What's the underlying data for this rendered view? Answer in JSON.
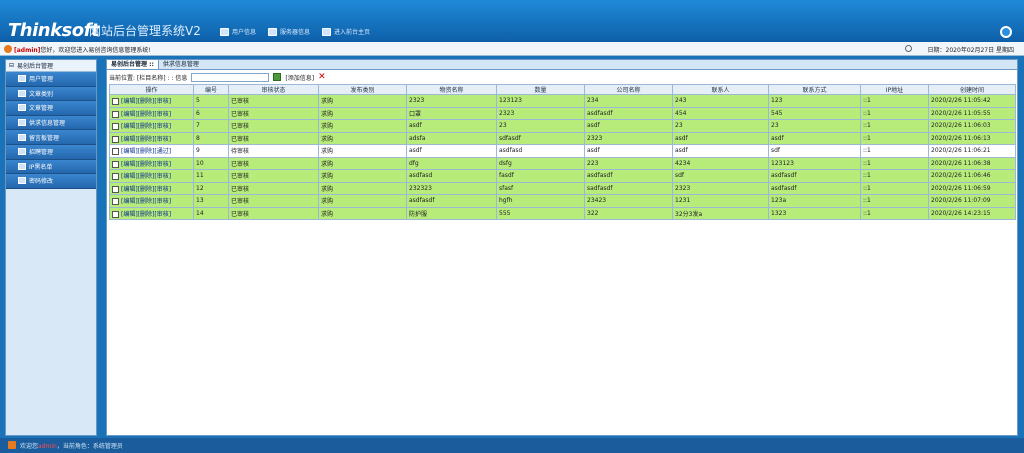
{
  "header": {
    "logo": "Thinksoft",
    "subtitle": "网站后台管理系统V2",
    "nav": [
      {
        "label": "用户信息"
      },
      {
        "label": "服务器信息"
      },
      {
        "label": "进入前台主页"
      }
    ]
  },
  "infobar": {
    "welcome_user": "[admin]",
    "welcome_text": "您好，欢迎您进入易创咨询信息管理系统!",
    "date": "日期：2020年02月27日 星期四"
  },
  "sidebar": {
    "root": "易创后台管理",
    "items": [
      {
        "label": "用户管理"
      },
      {
        "label": "文章类别"
      },
      {
        "label": "文章管理"
      },
      {
        "label": "供求信息管理"
      },
      {
        "label": "留言板管理"
      },
      {
        "label": "招聘管理"
      },
      {
        "label": "IP黑名单"
      },
      {
        "label": "密码修改"
      }
    ]
  },
  "tabs": [
    {
      "label": "易创后台管理 ::"
    },
    {
      "label": "供求信息管理"
    }
  ],
  "crumb": {
    "location": "当前位置: [栏目名称] : : 信息",
    "add_label": "[添加信息]"
  },
  "table": {
    "headers": [
      "操作",
      "编号",
      "审核状态",
      "发布类别",
      "物资名称",
      "数量",
      "公司名称",
      "联系人",
      "联系方式",
      "IP地址",
      "创建时间"
    ],
    "rows": [
      {
        "ops": [
          "[编辑]",
          "[删除]",
          "[审核]"
        ],
        "id": "5",
        "status": "已审核",
        "type": "求购",
        "name": "2323",
        "qty": "123123",
        "company": "234",
        "contact": "243",
        "phone": "123",
        "ip": "::1",
        "time": "2020/2/26 11:05:42"
      },
      {
        "ops": [
          "[编辑]",
          "[删除]",
          "[审核]"
        ],
        "id": "6",
        "status": "已审核",
        "type": "求购",
        "name": "口罩",
        "qty": "2323",
        "company": "asdfasdf",
        "contact": "454",
        "phone": "545",
        "ip": "::1",
        "time": "2020/2/26 11:05:55"
      },
      {
        "ops": [
          "[编辑]",
          "[删除]",
          "[审核]"
        ],
        "id": "7",
        "status": "已审核",
        "type": "求购",
        "name": "asdf",
        "qty": "23",
        "company": "asdf",
        "contact": "23",
        "phone": "23",
        "ip": "::1",
        "time": "2020/2/26 11:06:03"
      },
      {
        "ops": [
          "[编辑]",
          "[删除]",
          "[审核]"
        ],
        "id": "8",
        "status": "已审核",
        "type": "求购",
        "name": "adsfa",
        "qty": "sdfasdf",
        "company": "2323",
        "contact": "asdf",
        "phone": "asdf",
        "ip": "::1",
        "time": "2020/2/26 11:06:13"
      },
      {
        "ops": [
          "[编辑]",
          "[删除]",
          "[通过]"
        ],
        "id": "9",
        "status": "待审核",
        "type": "求购",
        "name": "asdf",
        "qty": "asdfasd",
        "company": "asdf",
        "contact": "asdf",
        "phone": "sdf",
        "ip": "::1",
        "time": "2020/2/26 11:06:21"
      },
      {
        "ops": [
          "[编辑]",
          "[删除]",
          "[审核]"
        ],
        "id": "10",
        "status": "已审核",
        "type": "求购",
        "name": "dfg",
        "qty": "dsfg",
        "company": "223",
        "contact": "4234",
        "phone": "123123",
        "ip": "::1",
        "time": "2020/2/26 11:06:38"
      },
      {
        "ops": [
          "[编辑]",
          "[删除]",
          "[审核]"
        ],
        "id": "11",
        "status": "已审核",
        "type": "求购",
        "name": "asdfasd",
        "qty": "fasdf",
        "company": "asdfasdf",
        "contact": "sdf",
        "phone": "asdfasdf",
        "ip": "::1",
        "time": "2020/2/26 11:06:46"
      },
      {
        "ops": [
          "[编辑]",
          "[删除]",
          "[审核]"
        ],
        "id": "12",
        "status": "已审核",
        "type": "求购",
        "name": "232323",
        "qty": "sfasf",
        "company": "sadfasdf",
        "contact": "2323",
        "phone": "asdfasdf",
        "ip": "::1",
        "time": "2020/2/26 11:06:59"
      },
      {
        "ops": [
          "[编辑]",
          "[删除]",
          "[审核]"
        ],
        "id": "13",
        "status": "已审核",
        "type": "求购",
        "name": "asdfasdf",
        "qty": "hgfh",
        "company": "23423",
        "contact": "1231",
        "phone": "123a",
        "ip": "::1",
        "time": "2020/2/26 11:07:09"
      },
      {
        "ops": [
          "[编辑]",
          "[删除]",
          "[审核]"
        ],
        "id": "14",
        "status": "已审核",
        "type": "求购",
        "name": "防护服",
        "qty": "555",
        "company": "322",
        "contact": "32分3发a",
        "phone": "1323",
        "ip": "::1",
        "time": "2020/2/26 14:23:15"
      }
    ]
  },
  "footer": {
    "prefix": "欢迎您",
    "user": "admin",
    "role": "，当前角色：系统管理员"
  }
}
